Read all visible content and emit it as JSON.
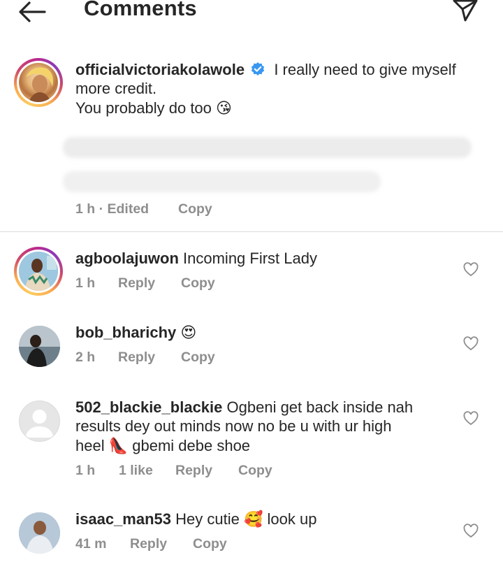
{
  "header": {
    "title": "Comments"
  },
  "post": {
    "username": "officialvictoriakolawole",
    "verified": true,
    "caption_line1": "I really need to give myself",
    "caption_line2": "more credit.",
    "caption_line3": "You probably do too",
    "caption_emoji": "😘",
    "time": "1 h · Edited",
    "copy_label": "Copy"
  },
  "comments": [
    {
      "username": "agboolajuwon",
      "text": "Incoming First Lady",
      "time": "1 h",
      "reply_label": "Reply",
      "copy_label": "Copy"
    },
    {
      "username": "bob_bharichy",
      "emoji": "😍",
      "time": "2 h",
      "reply_label": "Reply",
      "copy_label": "Copy"
    },
    {
      "username": "502_blackie_blackie",
      "text_line1": "Ogbeni get back inside nah",
      "text_line2": "results dey out minds now no be u with ur high",
      "text_line3_a": "heel",
      "text_line3_emoji": "👠",
      "text_line3_b": "gbemi debe shoe",
      "time": "1 h",
      "likes": "1 like",
      "reply_label": "Reply",
      "copy_label": "Copy"
    },
    {
      "username": "isaac_man53",
      "text_a": "Hey cutie",
      "emoji": "🥰",
      "text_b": "look up",
      "time": "41 m",
      "reply_label": "Reply",
      "copy_label": "Copy"
    }
  ],
  "colors": {
    "text": "#262626",
    "meta": "#8e8e8e",
    "verified": "#3897f0",
    "divider": "#dbdbdb"
  }
}
